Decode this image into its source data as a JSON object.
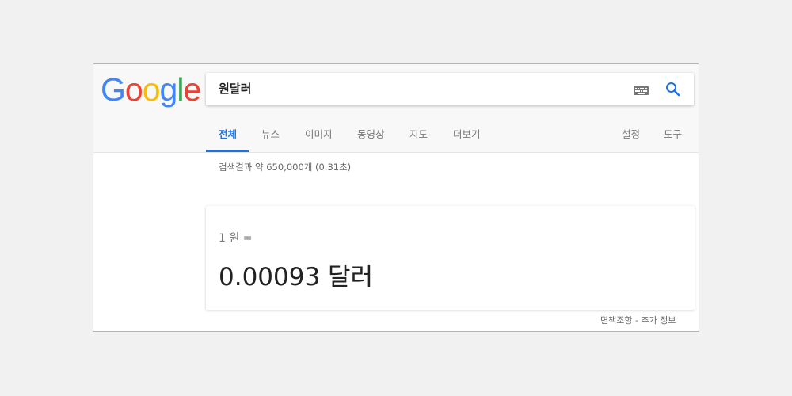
{
  "logo": {
    "letters": [
      "G",
      "o",
      "o",
      "g",
      "l",
      "e"
    ],
    "colors": [
      "#4285f4",
      "#ea4335",
      "#fbbc05",
      "#4285f4",
      "#34a853",
      "#ea4335"
    ]
  },
  "search": {
    "query": "원달러"
  },
  "icons": {
    "keyboard": "keyboard-icon",
    "search": "search-icon"
  },
  "tabs": [
    {
      "label": "전체",
      "active": true
    },
    {
      "label": "뉴스",
      "active": false
    },
    {
      "label": "이미지",
      "active": false
    },
    {
      "label": "동영상",
      "active": false
    },
    {
      "label": "지도",
      "active": false
    },
    {
      "label": "더보기",
      "active": false
    },
    {
      "label": "설정",
      "active": false
    },
    {
      "label": "도구",
      "active": false
    }
  ],
  "result_stats": "검색결과 약 650,000개 (0.31초)",
  "converter": {
    "from": "1 원 =",
    "to": "0.00093 달러"
  },
  "footer": {
    "disclaimer": "면책조항",
    "separator": " - ",
    "more_info": "추가 정보"
  },
  "colors": {
    "accent": "#1a73e8",
    "background": "#f1f1f1"
  }
}
